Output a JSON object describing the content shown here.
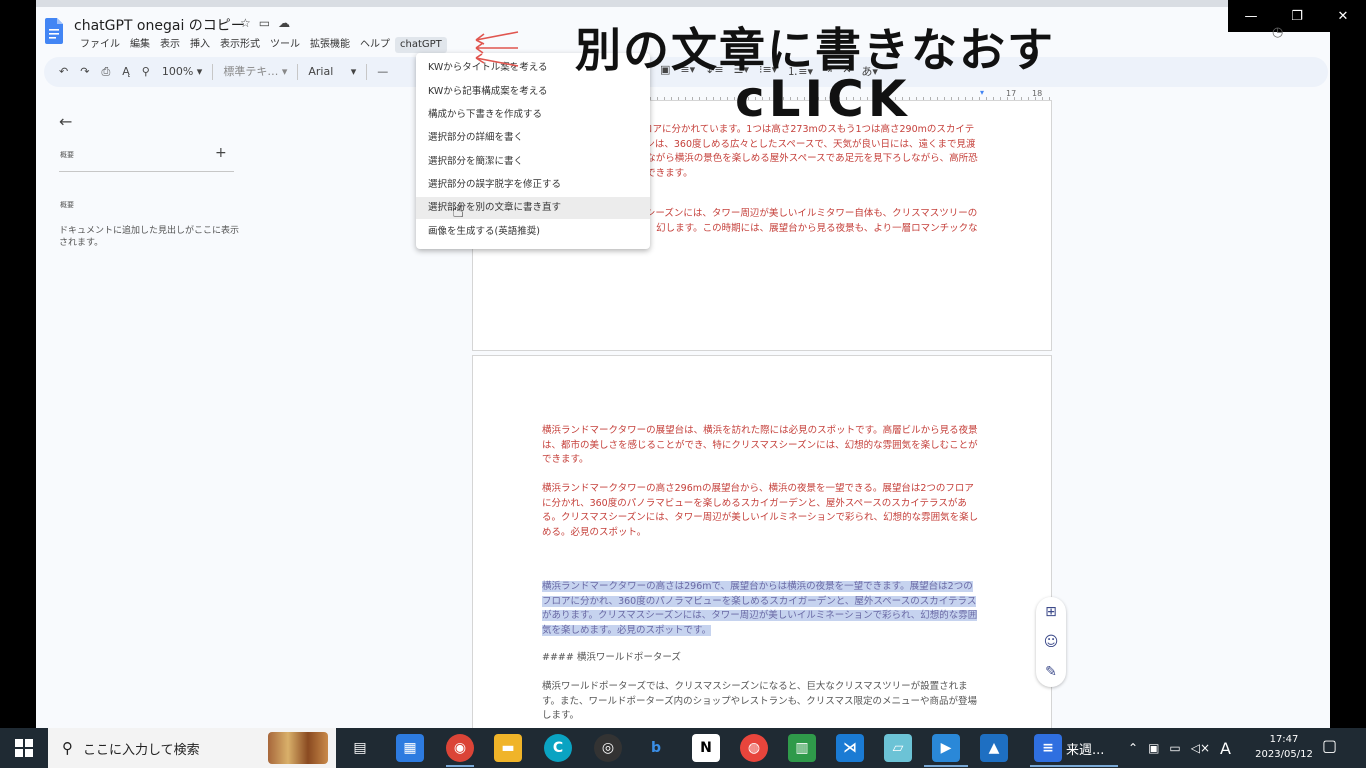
{
  "window": {
    "minimize_glyph": "—",
    "restore_glyph": "❐",
    "close_glyph": "✕"
  },
  "doc": {
    "title": "chatGPT onegai のコピー"
  },
  "menubar": [
    "ファイル",
    "編集",
    "表示",
    "挿入",
    "表示形式",
    "ツール",
    "拡張機能",
    "ヘルプ",
    "chatGPT"
  ],
  "toolbar": {
    "zoom": "100%",
    "style": "標準テキ…",
    "font": "Arial",
    "minus": "—"
  },
  "ruler": {
    "ticks": [
      "17",
      "18"
    ]
  },
  "outline": {
    "heading": "概要",
    "heading2": "概要",
    "note": "ドキュメントに追加した見出しがここに表示されます。"
  },
  "chatgpt_menu": {
    "items": [
      "KWからタイトル案を考える",
      "KWから記事構成案を考える",
      "構成から下書きを作成する",
      "選択部分の詳細を書く",
      "選択部分を簡潔に書く",
      "選択部分の誤字脱字を修正する",
      "選択部分を別の文章に書き直す",
      "画像を生成する(英語推奨)"
    ]
  },
  "page1": {
    "para1": "ーの展望台は、2つのフロアに分かれています。1つは高さ273mのスもう1つは高さ290mのスカイテラスです。スカイガーデンは、360度しめる広々としたスペースで、天気が良い日には、遠くまで見渡すこテラスは、風を感じながら横浜の景色を楽しめる屋外スペースであ足元を見下ろしながら、高所恐怖症に立ち向かうこともできます。",
    "para2": "クタワーは、クリスマスシーズンには、タワー周辺が美しいイルミタワー自体も、クリスマスツリーのようにライトアップされ、幻します。この時期には、展望台から見る夜景も、より一層ロマンチックな雰囲気を醸し出します。"
  },
  "page2": {
    "para1": "横浜ランドマークタワーの展望台は、横浜を訪れた際には必見のスポットです。高層ビルから見る夜景は、都市の美しさを感じることができ、特にクリスマスシーズンには、幻想的な雰囲気を楽しむことができます。",
    "para2": "横浜ランドマークタワーの高さ296mの展望台から、横浜の夜景を一望できる。展望台は2つのフロアに分かれ、360度のパノラマビューを楽しめるスカイガーデンと、屋外スペースのスカイテラスがある。クリスマスシーズンには、タワー周辺が美しいイルミネーションで彩られ、幻想的な雰囲気を楽しめる。必見のスポット。",
    "para3": "横浜ランドマークタワーの高さは296mで、展望台からは横浜の夜景を一望できます。展望台は2つのフロアに分かれ、360度のパノラマビューを楽しめるスカイガーデンと、屋外スペースのスカイテラスがあります。クリスマスシーズンには、タワー周辺が美しいイルミネーションで彩られ、幻想的な雰囲気を楽しめます。必見のスポットです。",
    "heading": "#### 横浜ワールドポーターズ",
    "para4": "横浜ワールドポーターズでは、クリスマスシーズンになると、巨大なクリスマスツリーが設置されます。また、ワールドポーターズ内のショップやレストランも、クリスマス限定のメニューや商品が登場します。"
  },
  "annotation": {
    "text": "別の文章に書きなおす",
    "click": "cLICK"
  },
  "taskbar": {
    "search_placeholder": "ここに入力して検索",
    "task_label": "来週...",
    "time": "17:47",
    "date": "2023/05/12",
    "ime": "A"
  },
  "colors": {
    "accent": "#1a73e8",
    "doc_text_red": "#c5403b",
    "highlight": "#c6d3ef",
    "taskbar": "#1f2a33"
  }
}
